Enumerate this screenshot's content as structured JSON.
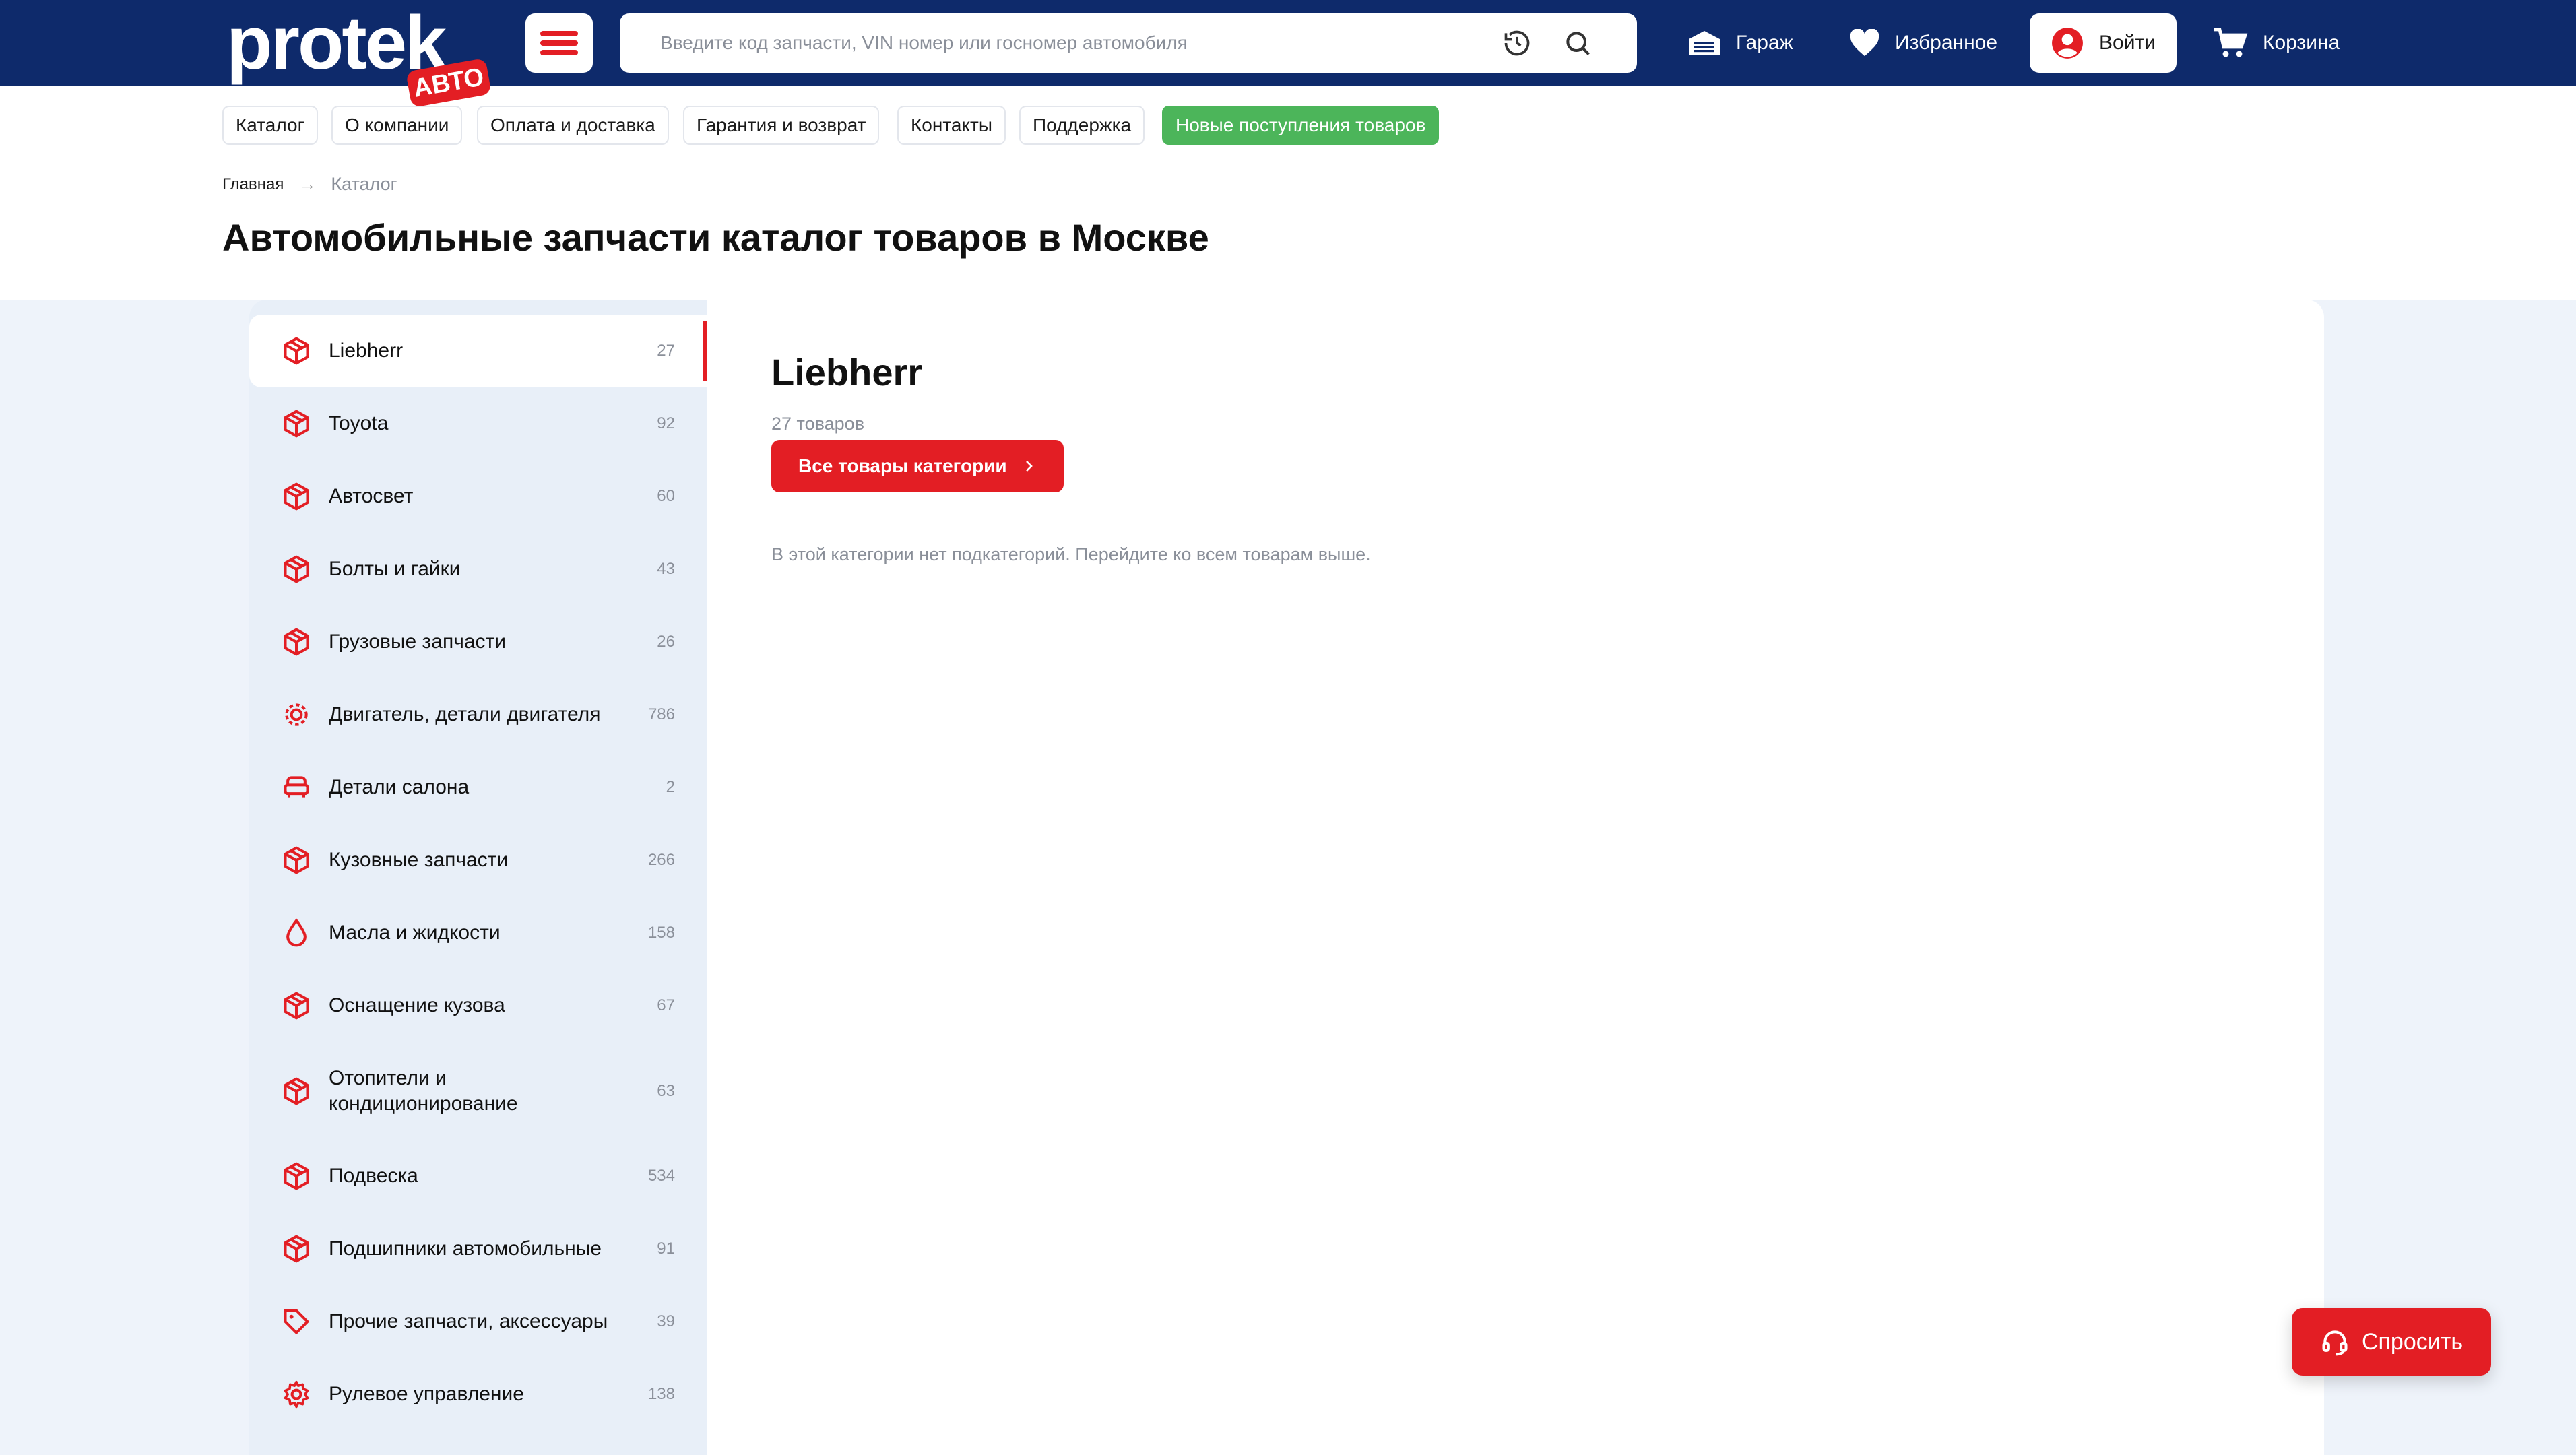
{
  "header": {
    "logo_text": "protek",
    "logo_badge": "АВТО",
    "search_placeholder": "Введите код запчасти, VIN номер или госномер автомобиля",
    "garage_label": "Гараж",
    "favorites_label": "Избранное",
    "login_label": "Войти",
    "cart_label": "Корзина"
  },
  "nav": {
    "items": [
      {
        "label": "Каталог"
      },
      {
        "label": "О компании"
      },
      {
        "label": "Оплата и доставка"
      },
      {
        "label": "Гарантия и возврат"
      },
      {
        "label": "Контакты"
      },
      {
        "label": "Поддержка"
      },
      {
        "label": "Новые поступления товаров"
      }
    ]
  },
  "breadcrumb": {
    "home": "Главная",
    "arrow": "→",
    "current": "Каталог"
  },
  "page_title": "Автомобильные запчасти каталог товаров в Москве",
  "sidebar": {
    "items": [
      {
        "label": "Liebherr",
        "count": "27",
        "icon": "box-icon"
      },
      {
        "label": "Toyota",
        "count": "92",
        "icon": "box-icon"
      },
      {
        "label": "Автосвет",
        "count": "60",
        "icon": "box-icon"
      },
      {
        "label": "Болты и гайки",
        "count": "43",
        "icon": "box-icon"
      },
      {
        "label": "Грузовые запчасти",
        "count": "26",
        "icon": "box-icon"
      },
      {
        "label": "Двигатель, детали двигателя",
        "count": "786",
        "icon": "engine-gear-icon"
      },
      {
        "label": "Детали салона",
        "count": "2",
        "icon": "car-seat-icon"
      },
      {
        "label": "Кузовные запчасти",
        "count": "266",
        "icon": "box-icon"
      },
      {
        "label": "Масла и жидкости",
        "count": "158",
        "icon": "drop-icon"
      },
      {
        "label": "Оснащение кузова",
        "count": "67",
        "icon": "box-icon"
      },
      {
        "label": "Отопители и кондиционирование",
        "count": "63",
        "icon": "box-icon"
      },
      {
        "label": "Подвеска",
        "count": "534",
        "icon": "box-icon"
      },
      {
        "label": "Подшипники автомобильные",
        "count": "91",
        "icon": "box-icon"
      },
      {
        "label": "Прочие запчасти, аксессуары",
        "count": "39",
        "icon": "tag-icon"
      },
      {
        "label": "Рулевое управление",
        "count": "138",
        "icon": "gear-icon"
      }
    ]
  },
  "category": {
    "title": "Liebherr",
    "subtitle": "27 товаров",
    "all_button": "Все товары категории",
    "empty_note": "В этой категории нет подкатегорий. Перейдите ко всем товарам выше."
  },
  "ask_button": "Спросить",
  "colors": {
    "header_bg": "#0e2a6b",
    "accent_red": "#e31e24",
    "green": "#4cb55a"
  }
}
